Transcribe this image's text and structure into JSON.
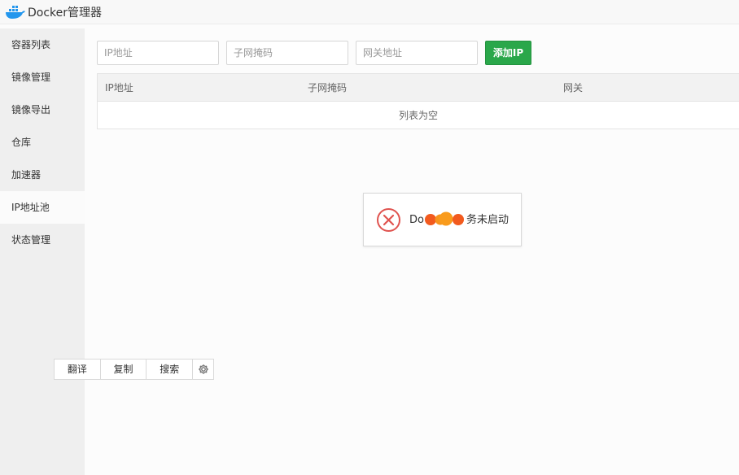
{
  "app": {
    "title": "Docker管理器",
    "logo_icon": "docker-whale-icon"
  },
  "sidebar": {
    "items": [
      {
        "label": "容器列表"
      },
      {
        "label": "镜像管理"
      },
      {
        "label": "镜像导出"
      },
      {
        "label": "仓库"
      },
      {
        "label": "加速器"
      },
      {
        "label": "IP地址池",
        "active": true
      },
      {
        "label": "状态管理"
      }
    ]
  },
  "toolbar": {
    "ip_placeholder": "IP地址",
    "subnet_placeholder": "子网掩码",
    "gateway_placeholder": "网关地址",
    "add_label": "添加IP",
    "add_color": "#2aa74a"
  },
  "table": {
    "columns": [
      "IP地址",
      "子网掩码",
      "网关"
    ],
    "empty_text": "列表为空"
  },
  "toast": {
    "message_prefix": "Do",
    "message_suffix": "务未启动",
    "icon": "error-circle-x-icon",
    "icon_color": "#e0534f"
  },
  "context_menu": {
    "items": [
      "翻译",
      "复制",
      "搜索"
    ],
    "settings_icon": "gear-icon"
  }
}
